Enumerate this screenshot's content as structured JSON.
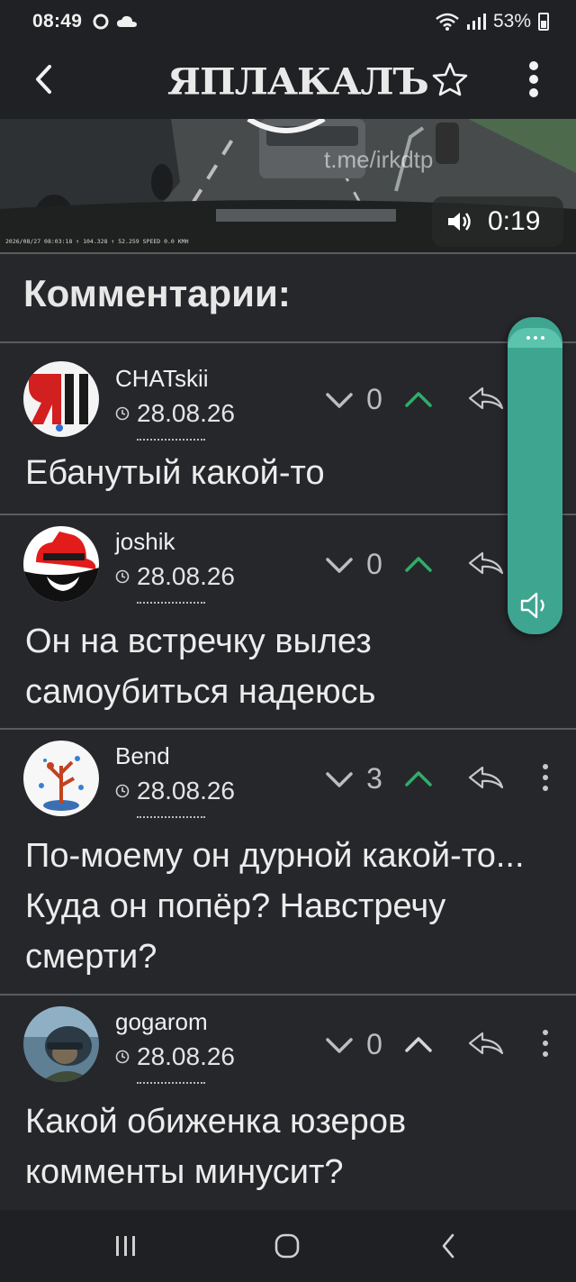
{
  "status_bar": {
    "time": "08:49",
    "battery": "53%"
  },
  "header": {
    "logo": "ЯПЛАКАЛЪ",
    "icons": [
      "back-arrow-icon",
      "star-icon",
      "more-vertical-icon"
    ]
  },
  "video": {
    "watermark": "t.me/irkdtp",
    "hud": "2026/08/27  08:03:18  ↑  104.328  ↑  52.259  SPEED  0.0  KMH",
    "timer": "0:19"
  },
  "comments_title": "Комментарии:",
  "comments": [
    {
      "username": "CHATskii",
      "date": "28.08.26",
      "votes": "0",
      "text": "Ебанутый какой-то"
    },
    {
      "username": "joshik",
      "date": "28.08.26",
      "votes": "0",
      "text": "Он на встречку вылез самоубиться надеюсь"
    },
    {
      "username": "Bend",
      "date": "28.08.26",
      "votes": "3",
      "text": "По-моему он дурной какой-то... Куда он попёр? Навстречу смерти?"
    },
    {
      "username": "gogarom",
      "date": "28.08.26",
      "votes": "0",
      "text": "Какой обиженка юзеров комменты минусит?"
    }
  ],
  "colors": {
    "background": "#26272b",
    "upvote_active": "#2fae6a",
    "side_panel": "#3ea591"
  }
}
